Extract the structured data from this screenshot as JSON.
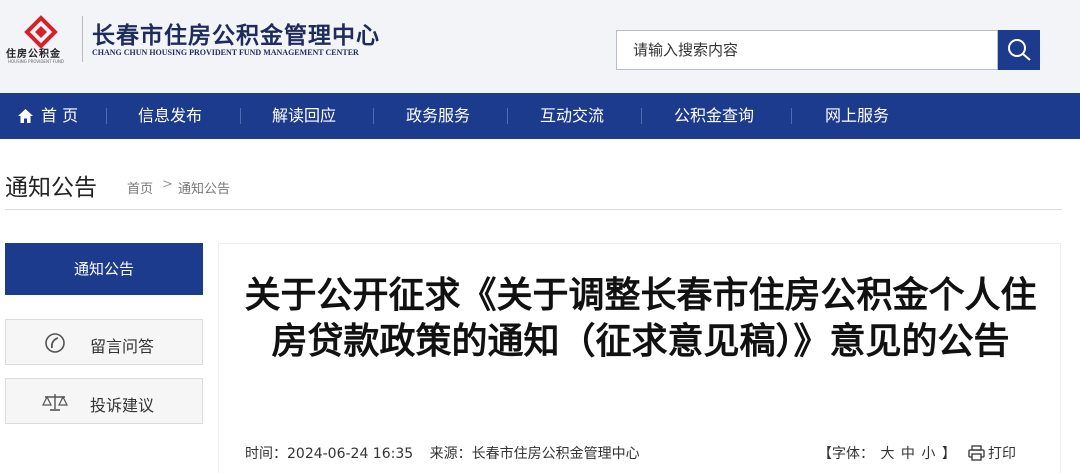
{
  "header": {
    "logo_small_cn": "住房公积金",
    "logo_small_en": "HOUSING PROVIDENT FUND",
    "title": "长春市住房公积金管理中心",
    "subtitle": "CHANG CHUN HOUSING PROVIDENT FUND MANAGEMENT CENTER",
    "search_placeholder": "请输入搜索内容",
    "brand_color": "#1d3b8c",
    "logo_color": "#d6202a"
  },
  "nav": {
    "items": [
      "首 页",
      "信息发布",
      "解读回应",
      "政务服务",
      "互动交流",
      "公积金查询",
      "网上服务"
    ]
  },
  "breadcrumb": {
    "section_title": "通知公告",
    "home": "首页",
    "separator": ">",
    "current": "通知公告"
  },
  "sidebar": {
    "active": "通知公告",
    "items": [
      {
        "label": "留言问答",
        "icon": "message-icon"
      },
      {
        "label": "投诉建议",
        "icon": "scale-icon"
      }
    ]
  },
  "article": {
    "title": "关于公开征求《关于调整长春市住房公积金个人住房贷款政策的通知（征求意见稿）》意见的公告",
    "time_label": "时间：",
    "time_value": "2024-06-24 16:35",
    "source_label": "来源：",
    "source_value": "长春市住房公积金管理中心",
    "font_label": "【字体：",
    "font_large": "大",
    "font_medium": "中",
    "font_small": "小",
    "font_close": "】",
    "print_label": "打印"
  }
}
